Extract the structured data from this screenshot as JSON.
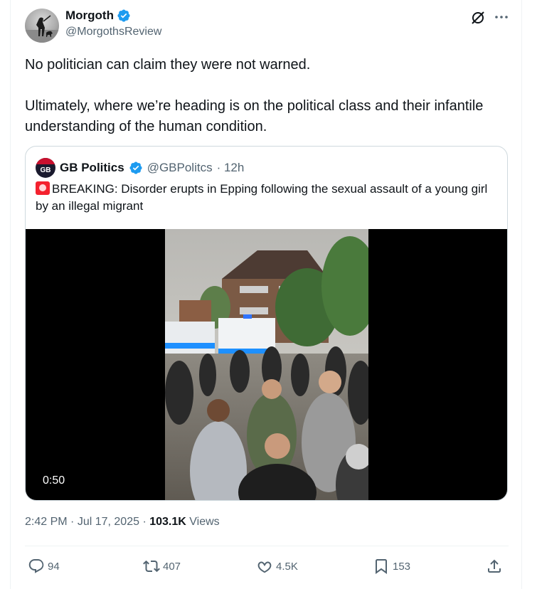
{
  "author": {
    "display_name": "Morgoth",
    "handle": "@MorgothsReview",
    "verified": true
  },
  "tweet": {
    "line1": "No politician can claim they were not warned.",
    "line2": "Ultimately, where we’re heading is on the political class and their infantile understanding of the human condition."
  },
  "quote": {
    "avatar_text": "GB",
    "display_name": "GB Politics",
    "handle": "@GBPolitcs",
    "time": "· 12h",
    "text": "BREAKING: Disorder erupts in Epping following the sexual assault of a young girl by an illegal migrant",
    "video_duration": "0:50"
  },
  "meta": {
    "time": "2:42 PM",
    "date": "· Jul 17, 2025",
    "dot": "·",
    "views_count": "103.1K",
    "views_label": "Views"
  },
  "actions": {
    "replies": "94",
    "reposts": "407",
    "likes": "4.5K",
    "bookmarks": "153"
  },
  "icons": {
    "verified": "verified-badge-icon",
    "grok": "grok-icon",
    "more": "more-icon",
    "reply": "reply-icon",
    "retweet": "retweet-icon",
    "like": "heart-icon",
    "bookmark": "bookmark-icon",
    "share": "share-icon",
    "siren": "siren-icon"
  },
  "colors": {
    "verified_blue": "#1d9bf0",
    "secondary_text": "#536471",
    "primary_text": "#0f1419",
    "border": "#cfd9de"
  }
}
